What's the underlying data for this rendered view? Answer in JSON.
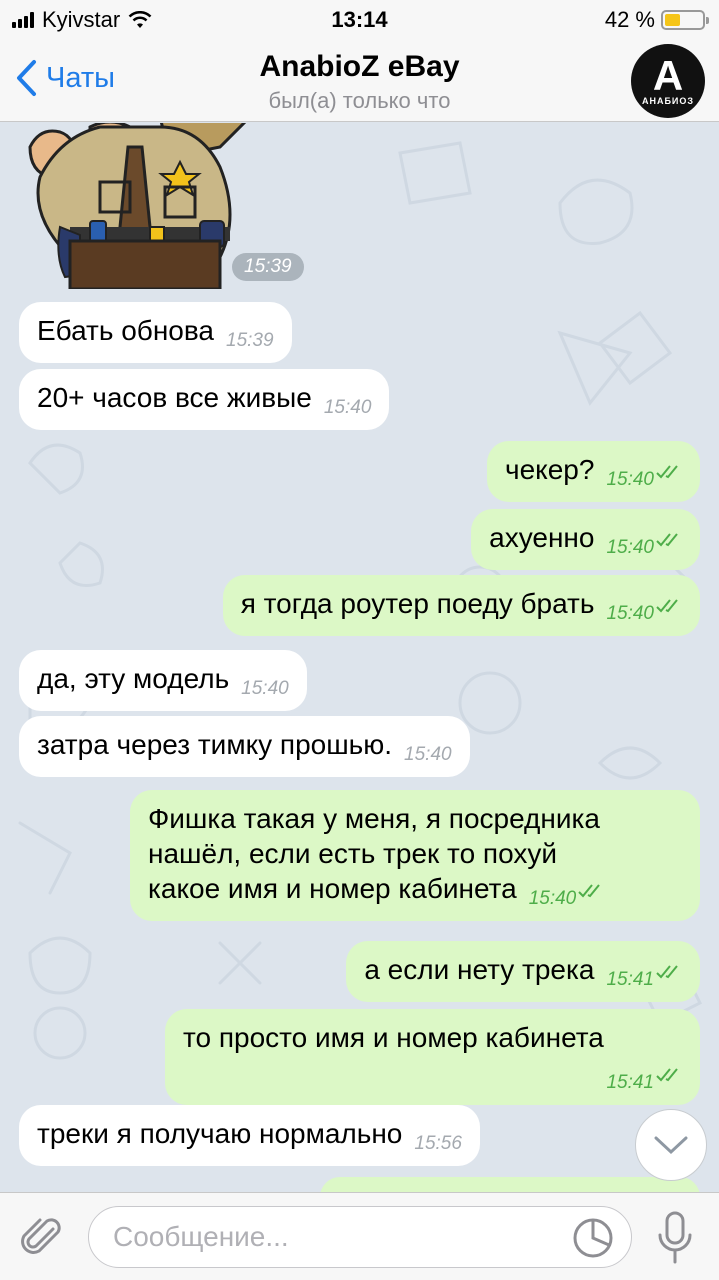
{
  "status_bar": {
    "carrier": "Kyivstar",
    "time": "13:14",
    "battery": "42 %",
    "battery_level": 0.42
  },
  "header": {
    "back_label": "Чаты",
    "title": "AnabioZ eBay",
    "subtitle": "был(а) только что",
    "avatar_letter": "A",
    "avatar_text": "АНАБИОЗ"
  },
  "sticker": {
    "time": "15:39"
  },
  "messages": [
    {
      "dir": "in",
      "text": "Ебать обнова",
      "time": "15:39"
    },
    {
      "dir": "in",
      "text": "20+ часов все живые",
      "time": "15:40"
    },
    {
      "dir": "out",
      "text": "чекер?",
      "time": "15:40"
    },
    {
      "dir": "out",
      "text": "ахуенно",
      "time": "15:40"
    },
    {
      "dir": "out",
      "text": "я тогда роутер поеду брать",
      "time": "15:40"
    },
    {
      "dir": "in",
      "text": "да, эту модель",
      "time": "15:40"
    },
    {
      "dir": "in",
      "text": "затра через тимку прошью.",
      "time": "15:40"
    },
    {
      "dir": "out",
      "lines": [
        "Фишка такая у меня, я посредника",
        "нашёл, если есть трек то похуй",
        "какое имя и номер кабинета"
      ],
      "time": "15:40"
    },
    {
      "dir": "out",
      "text": "а если нету трека",
      "time": "15:41"
    },
    {
      "dir": "out",
      "text": "то просто имя и номер кабинета",
      "time": "15:41"
    },
    {
      "dir": "in",
      "text": "треки я получаю нормально",
      "time": "15:56"
    }
  ],
  "composer": {
    "placeholder": "Сообщение..."
  }
}
